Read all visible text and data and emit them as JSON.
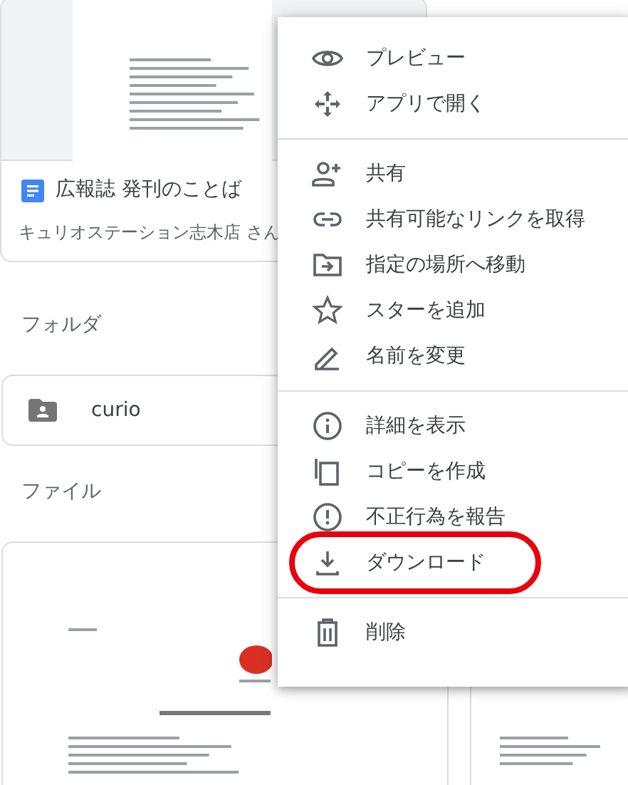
{
  "recent_file": {
    "title": "広報誌 発刊のことば",
    "owner": "キュリオステーション志木店 さん"
  },
  "folders_heading": "フォルダ",
  "folders": [
    {
      "name": "curio"
    }
  ],
  "files_heading": "ファイル",
  "context_menu": {
    "groups": [
      [
        {
          "kind": "eye",
          "label": "プレビュー",
          "highlighted": false
        },
        {
          "kind": "move",
          "label": "アプリで開く",
          "highlighted": false
        }
      ],
      [
        {
          "kind": "person-add",
          "label": "共有",
          "highlighted": false
        },
        {
          "kind": "link",
          "label": "共有可能なリンクを取得",
          "highlighted": false
        },
        {
          "kind": "folder-move",
          "label": "指定の場所へ移動",
          "highlighted": false
        },
        {
          "kind": "star",
          "label": "スターを追加",
          "highlighted": false
        },
        {
          "kind": "pencil",
          "label": "名前を変更",
          "highlighted": false
        }
      ],
      [
        {
          "kind": "info",
          "label": "詳細を表示",
          "highlighted": false
        },
        {
          "kind": "copy",
          "label": "コピーを作成",
          "highlighted": false
        },
        {
          "kind": "alert",
          "label": "不正行為を報告",
          "highlighted": false
        },
        {
          "kind": "download",
          "label": "ダウンロード",
          "highlighted": true
        }
      ],
      [
        {
          "kind": "trash",
          "label": "削除",
          "highlighted": false
        }
      ]
    ]
  }
}
